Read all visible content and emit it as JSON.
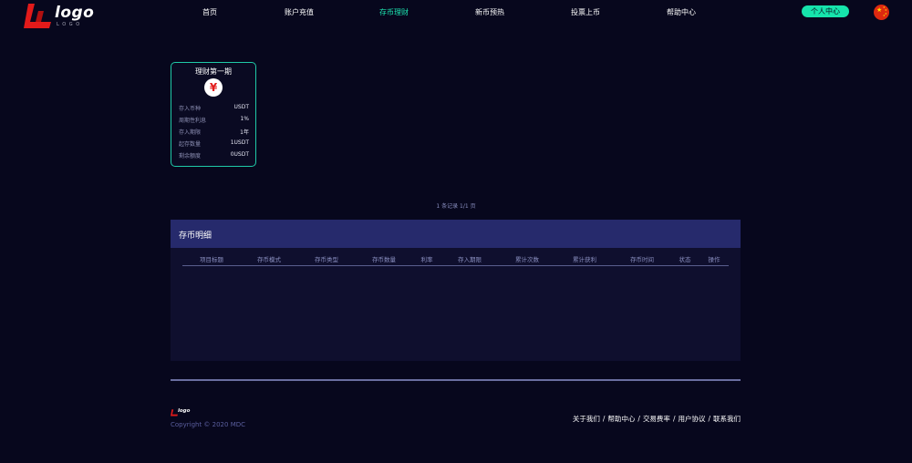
{
  "header": {
    "logo": {
      "word": "logo",
      "sub": "LOGO",
      "brand_color": "#e21a1a"
    },
    "nav": [
      {
        "id": "home",
        "label": "首页",
        "active": false
      },
      {
        "id": "recharge",
        "label": "账户充值",
        "active": false
      },
      {
        "id": "deposit",
        "label": "存币理财",
        "active": true
      },
      {
        "id": "newcoin",
        "label": "新币预热",
        "active": false
      },
      {
        "id": "vote",
        "label": "投票上币",
        "active": false
      },
      {
        "id": "help",
        "label": "帮助中心",
        "active": false
      }
    ],
    "profile_label": "个人中心",
    "flag_icon": "china-flag-icon",
    "accent_color": "#1de7b2"
  },
  "product": {
    "title": "理财第一期",
    "coin_symbol": "¥",
    "rows": [
      {
        "key": "存入币种",
        "value": "USDT"
      },
      {
        "key": "周期性利息",
        "value": "1%"
      },
      {
        "key": "存入期限",
        "value": "1年"
      },
      {
        "key": "起存数量",
        "value": "1USDT"
      },
      {
        "key": "剩余额度",
        "value": "0USDT"
      }
    ]
  },
  "pagination": {
    "text": "1 条记录 1/1 页"
  },
  "records": {
    "title": "存币明细",
    "columns": [
      "项目标题",
      "存币模式",
      "存币类型",
      "存币数量",
      "利率",
      "存入期限",
      "累计次数",
      "累计获利",
      "存币时间",
      "状态",
      "操作"
    ],
    "rows": []
  },
  "footer": {
    "logo_word": "logo",
    "copyright": "Copyright © 2020 MDC",
    "links": [
      "关于我们",
      "帮助中心",
      "交易费率",
      "用户协议",
      "联系我们"
    ]
  }
}
